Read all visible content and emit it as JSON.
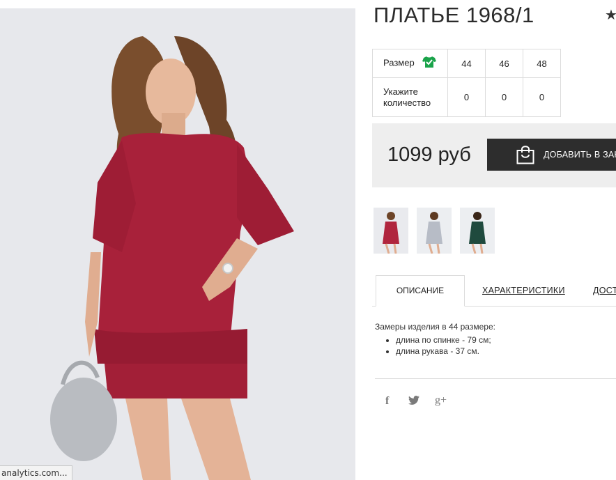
{
  "product": {
    "title": "ПЛАТЬЕ 1968/1"
  },
  "sizes": {
    "row_label": "Размер",
    "qty_label_line1": "Укажите",
    "qty_label_line2": "количество",
    "values": [
      "44",
      "46",
      "48"
    ],
    "quantities": [
      "0",
      "0",
      "0"
    ]
  },
  "price": {
    "amount": "1099 руб",
    "add_to_cart": "ДОБАВИТЬ В ЗАКАЗ"
  },
  "thumbnails": [
    {
      "label": "red dress",
      "color": "#b0253e"
    },
    {
      "label": "grey dress",
      "color": "#b7bcc6"
    },
    {
      "label": "green dress",
      "color": "#1f4a3e"
    }
  ],
  "tabs": [
    "ОПИСАНИЕ",
    "ХАРАКТЕРИСТИКИ",
    "ДОСТАВКА"
  ],
  "description": {
    "intro": "Замеры изделия в 44 размере:",
    "items": [
      "длина по спинке - 79 см;",
      "длина рукава - 37 см."
    ]
  },
  "social": {
    "facebook": "f",
    "twitter": "🐦",
    "googleplus": "g+"
  },
  "status_bar": "analytics.com...",
  "colors": {
    "dress": "#a8213a",
    "accent_green": "#1aa34a",
    "button_dark": "#2d2d2d",
    "price_bg": "#eeeeee"
  }
}
